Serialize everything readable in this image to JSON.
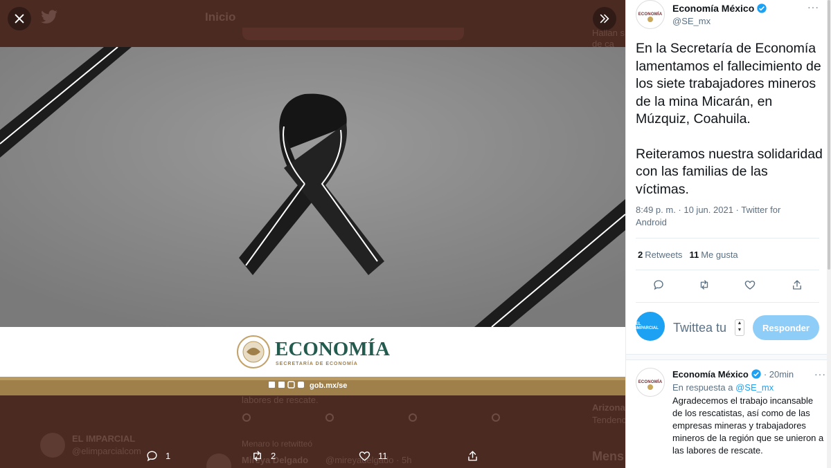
{
  "background": {
    "header_title": "Inicio",
    "snippet_right_1": "Hallan s",
    "snippet_right_2": "de ca",
    "rescue_snippet": "labores de rescate.",
    "user1_name": "EL IMPARCIAL",
    "user1_handle": "@elimparcialcom",
    "retweet_note": "Menaro lo retwitteó",
    "user2_name": "Mireya Delgado",
    "user2_handle": "@mireyadelgado · 5h",
    "right_arizona": "Arizona",
    "right_trend": "Tendencia",
    "right_mensajes": "Mens"
  },
  "media": {
    "brand_name": "ECONOMÍA",
    "brand_subtitle": "SECRETARÍA DE ECONOMÍA",
    "url": "gob.mx/se",
    "colors": {
      "gray": "#8e8e8e",
      "green": "#235b4e",
      "gold": "#9f7f4a",
      "ribbon": "#1a1a1a"
    }
  },
  "actions": {
    "reply_count": "1",
    "retweet_count": "2",
    "like_count": "11"
  },
  "tweet": {
    "author_name": "Economía México",
    "author_handle": "@SE_mx",
    "avatar_text": "ECONOMÍA",
    "paragraph1": "En la Secretaría de Economía lamentamos el fallecimiento de los siete trabajadores mineros de la mina Micarán, en Múzquiz, Coahuila.",
    "paragraph2": "Reiteramos nuestra solidaridad con las familias de las víctimas.",
    "timestamp": "8:49 p. m. · 10 jun. 2021 · Twitter for Android",
    "retweets_count": "2",
    "retweets_label": "Retweets",
    "likes_count": "11",
    "likes_label": "Me gusta"
  },
  "compose": {
    "avatar_text": "EL IMPARCIAL",
    "placeholder": "Twittea tu",
    "button": "Responder"
  },
  "reply": {
    "author_name": "Economía México",
    "time": "· 20min",
    "in_reply_to_label": "En respuesta a",
    "in_reply_to_handle": "@SE_mx",
    "text": "Agradecemos el trabajo incansable de los rescatistas, así como de las empresas mineras y trabajadores mineros de la región que se unieron a las labores de rescate."
  }
}
